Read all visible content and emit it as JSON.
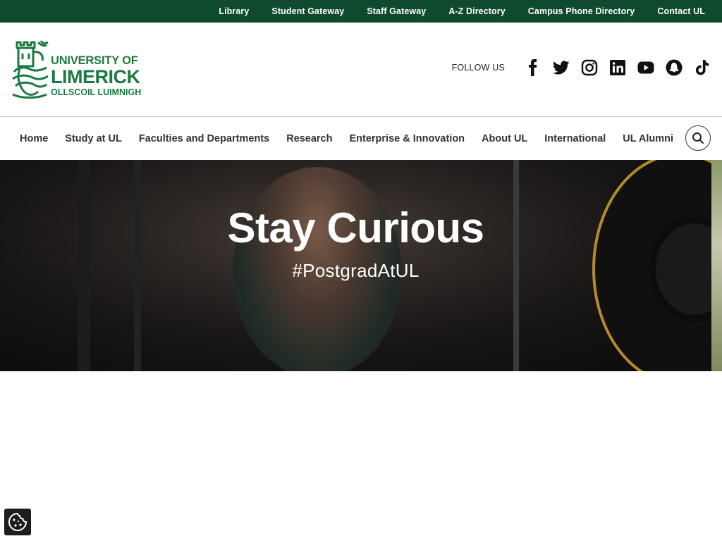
{
  "utility_nav": {
    "items": [
      "Library",
      "Student Gateway",
      "Staff Gateway",
      "A-Z Directory",
      "Campus Phone Directory",
      "Contact UL"
    ]
  },
  "logo": {
    "line1": "UNIVERSITY OF",
    "line2": "LIMERICK",
    "line3": "OLLSCOIL LUIMNIGH"
  },
  "social": {
    "label": "FOLLOW US",
    "icons": [
      "facebook-icon",
      "twitter-icon",
      "instagram-icon",
      "linkedin-icon",
      "youtube-icon",
      "snapchat-icon",
      "tiktok-icon"
    ]
  },
  "main_nav": {
    "items": [
      "Home",
      "Study at UL",
      "Faculties and Departments",
      "Research",
      "Enterprise & Innovation",
      "About UL",
      "International",
      "UL Alumni"
    ]
  },
  "hero": {
    "title": "Stay Curious",
    "subtitle": "#PostgradAtUL"
  },
  "colors": {
    "brand_dark_green": "#0f4a2f",
    "brand_green": "#1b7a3f"
  }
}
